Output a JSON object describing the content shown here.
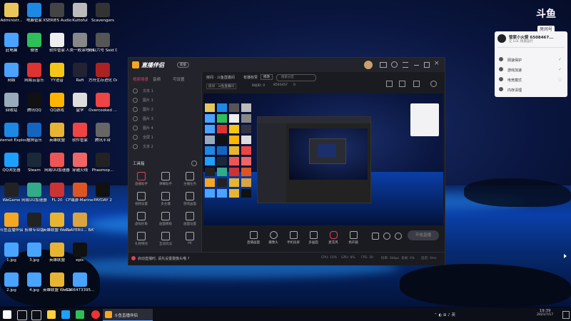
{
  "desktop_icons": [
    {
      "label": "Administr...",
      "color": "#e8c65a"
    },
    {
      "label": "电脑管家",
      "color": "#1e88e5"
    },
    {
      "label": "XSERIES Audio ...",
      "color": "#444"
    },
    {
      "label": "Kuttoful",
      "color": "#bbb"
    },
    {
      "label": "Scavengers",
      "color": "#333"
    },
    {
      "label": "此电脑",
      "color": "#4aa3ff"
    },
    {
      "label": "微信",
      "color": "#2fbf5a"
    },
    {
      "label": "软件管家",
      "color": "#eee"
    },
    {
      "label": "人类一败涂地 Human Fal...",
      "color": "#888"
    },
    {
      "label": "彩虹六号 Seid D...",
      "color": "#555"
    },
    {
      "label": "网络",
      "color": "#4aa3ff"
    },
    {
      "label": "网易云音乐",
      "color": "#d33"
    },
    {
      "label": "YY语音",
      "color": "#f5c518"
    },
    {
      "label": "Raft",
      "color": "#223"
    },
    {
      "label": "方舟生存进化 Dowrie",
      "color": "#a22"
    },
    {
      "label": "回收站",
      "color": "#9ab"
    },
    {
      "label": "腾讯QQ",
      "color": "#111"
    },
    {
      "label": "QQ游戏",
      "color": "#ffb400"
    },
    {
      "label": "盒学",
      "color": "#ddd"
    },
    {
      "label": "Overcooked ...",
      "color": "#e44"
    },
    {
      "label": "Internet Explorer",
      "color": "#1e88e5"
    },
    {
      "label": "酷狗音乐",
      "color": "#1565c0"
    },
    {
      "label": "英雄联盟",
      "color": "#e7b531"
    },
    {
      "label": "软件管家",
      "color": "#e44"
    },
    {
      "label": "腾讯平台",
      "color": "#666"
    },
    {
      "label": "QQ浏览器",
      "color": "#1ea0ff"
    },
    {
      "label": "Steam",
      "color": "#1b2838"
    },
    {
      "label": "网易UU加速器",
      "color": "#ee5555"
    },
    {
      "label": "穿越火线",
      "color": "#e66"
    },
    {
      "label": "Phasmop...",
      "color": "#222"
    },
    {
      "label": "WeGame",
      "color": "#222"
    },
    {
      "label": "网易UU加速器",
      "color": "#3a8"
    },
    {
      "label": "FL 20",
      "color": "#c33"
    },
    {
      "label": "CF端游·Marine ...",
      "color": "#d52"
    },
    {
      "label": "PAYDAY 2",
      "color": "#111"
    },
    {
      "label": "斗鱼直播伴侣",
      "color": "#f5a623"
    },
    {
      "label": "剪映专业版",
      "color": "#222"
    },
    {
      "label": "英雄联盟 WeGame版",
      "color": "#e7b531"
    },
    {
      "label": "PLAYERU... BATTLEGR...",
      "color": "#d9a441"
    },
    {
      "label": "",
      "color": "transparent"
    },
    {
      "label": "1.jpg",
      "color": "#4aa3ff"
    },
    {
      "label": "3.jpg",
      "color": "#4aa3ff"
    },
    {
      "label": "英雄联盟",
      "color": "#e7b531"
    },
    {
      "label": "epic",
      "color": "#111"
    },
    {
      "label": "",
      "color": "transparent"
    },
    {
      "label": "2.jpg",
      "color": "#4aa3ff"
    },
    {
      "label": "4.jpg",
      "color": "#4aa3ff"
    },
    {
      "label": "英雄联盟 WeGame版",
      "color": "#e7b531"
    },
    {
      "label": "6366473395...",
      "color": "#4aa3ff"
    }
  ],
  "app": {
    "title": "直播伴侣",
    "version_badge": "新版",
    "left_tabs": [
      "视频场景",
      "音频",
      "可设置"
    ],
    "layers": [
      "文本 1",
      "图片 1",
      "图片 2",
      "图片 3",
      "图片 4",
      "全屏 1",
      "文本 2"
    ],
    "tools_header": "工具箱",
    "tools": [
      "直播助手",
      "弹幕助手",
      "主播任务",
      "视频设置",
      "多主播",
      "游戏画面",
      "虚拟形象",
      "画面模板",
      "画面设置",
      "礼物特效",
      "互动玩法",
      "PK"
    ],
    "notice": "启动直播时, 请先设置摄像头哦 ?",
    "top_info": {
      "room_label": "房间 · 斗鱼直播间",
      "category_label": "有播有赞",
      "edit_label": "修改",
      "search_placeholder": "搜索分区",
      "room_id_label": "房间 · 斗鱼直播间",
      "stats": "B站ID: 0",
      "fans": "8593457",
      "hot": "0"
    },
    "bottom_controls": [
      "直播画面",
      "摄像头",
      "手机投屏",
      "多画面",
      "麦克风",
      "扬声器"
    ],
    "start_button": "开始直播",
    "status_bar": [
      "CPU: 10%",
      "GPU: 8%",
      "FPS: 30",
      "码率: 0kbps",
      "丢帧: 0%",
      "延迟: 0ms"
    ]
  },
  "popup": {
    "title": "管家小火箭 6508467...",
    "subtitle": "让 LOL 快速运行",
    "rows": [
      "网速保护",
      "游戏加速",
      "电竞模式",
      "内存清理"
    ]
  },
  "brand": {
    "line1": "斗鱼",
    "line2": "房间号"
  },
  "taskbar": {
    "active_app": "斗鱼直播伴侣",
    "time": "19:39",
    "date": "2021/7/17"
  }
}
